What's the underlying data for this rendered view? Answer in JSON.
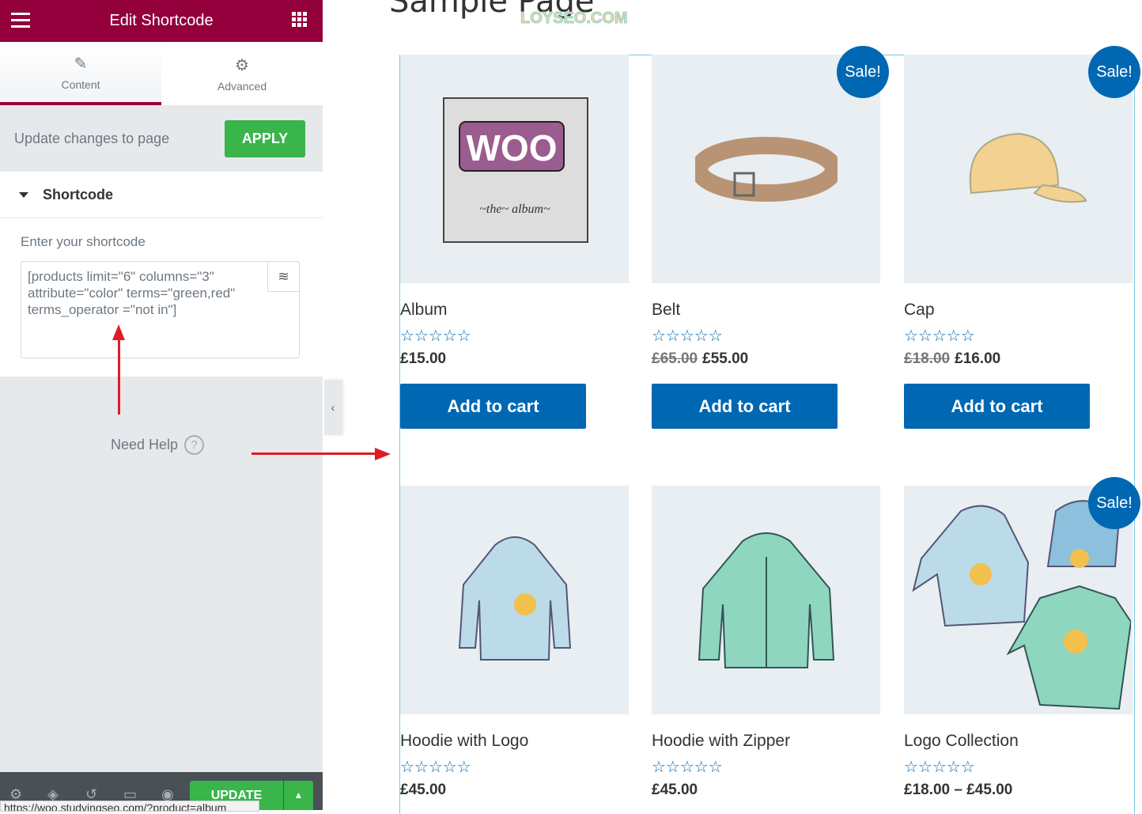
{
  "sidebar": {
    "title": "Edit Shortcode",
    "tabs": [
      {
        "label": "Content",
        "icon": "pencil-icon",
        "active": true
      },
      {
        "label": "Advanced",
        "icon": "gear-icon",
        "active": false
      }
    ],
    "update_text": "Update changes to page",
    "apply_label": "APPLY",
    "section_title": "Shortcode",
    "field_label": "Enter your shortcode",
    "shortcode_value": "[products  limit=\"6\" columns=\"3\" attribute=\"color\" terms=\"green,red\" terms_operator =\"not in\"]",
    "need_help": "Need Help",
    "update_label": "UPDATE",
    "status_url": "https://woo.studyingseo.com/?product=album"
  },
  "page": {
    "title": "Sample Page",
    "watermark": "LOYSEO.COM"
  },
  "colors": {
    "header": "#93003c",
    "apply": "#39b54a",
    "accent": "#0068b3",
    "annotation": "#e01b24"
  },
  "products": [
    {
      "name": "Album",
      "stars": "☆☆☆☆☆",
      "old_price": "",
      "price": "£15.00",
      "sale": "",
      "button": "Add to cart",
      "image": "album"
    },
    {
      "name": "Belt",
      "stars": "☆☆☆☆☆",
      "old_price": "£65.00",
      "price": "£55.00",
      "sale": "Sale!",
      "button": "Add to cart",
      "image": "belt"
    },
    {
      "name": "Cap",
      "stars": "☆☆☆☆☆",
      "old_price": "£18.00",
      "price": "£16.00",
      "sale": "Sale!",
      "button": "Add to cart",
      "image": "cap"
    },
    {
      "name": "Hoodie with Logo",
      "stars": "☆☆☆☆☆",
      "old_price": "",
      "price": "£45.00",
      "sale": "",
      "button": "",
      "image": "hoodie"
    },
    {
      "name": "Hoodie with Zipper",
      "stars": "☆☆☆☆☆",
      "old_price": "",
      "price": "£45.00",
      "sale": "",
      "button": "",
      "image": "hoodie-zipper"
    },
    {
      "name": "Logo Collection",
      "stars": "☆☆☆☆☆",
      "old_price": "",
      "price": "£18.00 – £45.00",
      "sale": "Sale!",
      "button": "",
      "image": "logo-collection"
    }
  ],
  "album_art": {
    "logo": "WOO",
    "caption": "~the~ album~"
  }
}
